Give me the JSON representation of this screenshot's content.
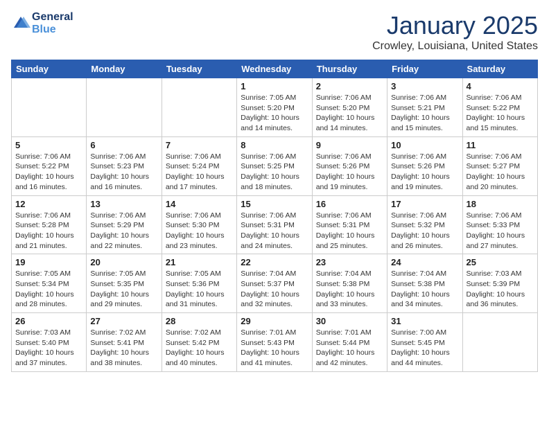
{
  "header": {
    "logo_line1": "General",
    "logo_line2": "Blue",
    "month": "January 2025",
    "location": "Crowley, Louisiana, United States"
  },
  "days_of_week": [
    "Sunday",
    "Monday",
    "Tuesday",
    "Wednesday",
    "Thursday",
    "Friday",
    "Saturday"
  ],
  "weeks": [
    [
      {
        "day": "",
        "info": ""
      },
      {
        "day": "",
        "info": ""
      },
      {
        "day": "",
        "info": ""
      },
      {
        "day": "1",
        "info": "Sunrise: 7:05 AM\nSunset: 5:20 PM\nDaylight: 10 hours\nand 14 minutes."
      },
      {
        "day": "2",
        "info": "Sunrise: 7:06 AM\nSunset: 5:20 PM\nDaylight: 10 hours\nand 14 minutes."
      },
      {
        "day": "3",
        "info": "Sunrise: 7:06 AM\nSunset: 5:21 PM\nDaylight: 10 hours\nand 15 minutes."
      },
      {
        "day": "4",
        "info": "Sunrise: 7:06 AM\nSunset: 5:22 PM\nDaylight: 10 hours\nand 15 minutes."
      }
    ],
    [
      {
        "day": "5",
        "info": "Sunrise: 7:06 AM\nSunset: 5:22 PM\nDaylight: 10 hours\nand 16 minutes."
      },
      {
        "day": "6",
        "info": "Sunrise: 7:06 AM\nSunset: 5:23 PM\nDaylight: 10 hours\nand 16 minutes."
      },
      {
        "day": "7",
        "info": "Sunrise: 7:06 AM\nSunset: 5:24 PM\nDaylight: 10 hours\nand 17 minutes."
      },
      {
        "day": "8",
        "info": "Sunrise: 7:06 AM\nSunset: 5:25 PM\nDaylight: 10 hours\nand 18 minutes."
      },
      {
        "day": "9",
        "info": "Sunrise: 7:06 AM\nSunset: 5:26 PM\nDaylight: 10 hours\nand 19 minutes."
      },
      {
        "day": "10",
        "info": "Sunrise: 7:06 AM\nSunset: 5:26 PM\nDaylight: 10 hours\nand 19 minutes."
      },
      {
        "day": "11",
        "info": "Sunrise: 7:06 AM\nSunset: 5:27 PM\nDaylight: 10 hours\nand 20 minutes."
      }
    ],
    [
      {
        "day": "12",
        "info": "Sunrise: 7:06 AM\nSunset: 5:28 PM\nDaylight: 10 hours\nand 21 minutes."
      },
      {
        "day": "13",
        "info": "Sunrise: 7:06 AM\nSunset: 5:29 PM\nDaylight: 10 hours\nand 22 minutes."
      },
      {
        "day": "14",
        "info": "Sunrise: 7:06 AM\nSunset: 5:30 PM\nDaylight: 10 hours\nand 23 minutes."
      },
      {
        "day": "15",
        "info": "Sunrise: 7:06 AM\nSunset: 5:31 PM\nDaylight: 10 hours\nand 24 minutes."
      },
      {
        "day": "16",
        "info": "Sunrise: 7:06 AM\nSunset: 5:31 PM\nDaylight: 10 hours\nand 25 minutes."
      },
      {
        "day": "17",
        "info": "Sunrise: 7:06 AM\nSunset: 5:32 PM\nDaylight: 10 hours\nand 26 minutes."
      },
      {
        "day": "18",
        "info": "Sunrise: 7:06 AM\nSunset: 5:33 PM\nDaylight: 10 hours\nand 27 minutes."
      }
    ],
    [
      {
        "day": "19",
        "info": "Sunrise: 7:05 AM\nSunset: 5:34 PM\nDaylight: 10 hours\nand 28 minutes."
      },
      {
        "day": "20",
        "info": "Sunrise: 7:05 AM\nSunset: 5:35 PM\nDaylight: 10 hours\nand 29 minutes."
      },
      {
        "day": "21",
        "info": "Sunrise: 7:05 AM\nSunset: 5:36 PM\nDaylight: 10 hours\nand 31 minutes."
      },
      {
        "day": "22",
        "info": "Sunrise: 7:04 AM\nSunset: 5:37 PM\nDaylight: 10 hours\nand 32 minutes."
      },
      {
        "day": "23",
        "info": "Sunrise: 7:04 AM\nSunset: 5:38 PM\nDaylight: 10 hours\nand 33 minutes."
      },
      {
        "day": "24",
        "info": "Sunrise: 7:04 AM\nSunset: 5:38 PM\nDaylight: 10 hours\nand 34 minutes."
      },
      {
        "day": "25",
        "info": "Sunrise: 7:03 AM\nSunset: 5:39 PM\nDaylight: 10 hours\nand 36 minutes."
      }
    ],
    [
      {
        "day": "26",
        "info": "Sunrise: 7:03 AM\nSunset: 5:40 PM\nDaylight: 10 hours\nand 37 minutes."
      },
      {
        "day": "27",
        "info": "Sunrise: 7:02 AM\nSunset: 5:41 PM\nDaylight: 10 hours\nand 38 minutes."
      },
      {
        "day": "28",
        "info": "Sunrise: 7:02 AM\nSunset: 5:42 PM\nDaylight: 10 hours\nand 40 minutes."
      },
      {
        "day": "29",
        "info": "Sunrise: 7:01 AM\nSunset: 5:43 PM\nDaylight: 10 hours\nand 41 minutes."
      },
      {
        "day": "30",
        "info": "Sunrise: 7:01 AM\nSunset: 5:44 PM\nDaylight: 10 hours\nand 42 minutes."
      },
      {
        "day": "31",
        "info": "Sunrise: 7:00 AM\nSunset: 5:45 PM\nDaylight: 10 hours\nand 44 minutes."
      },
      {
        "day": "",
        "info": ""
      }
    ]
  ]
}
